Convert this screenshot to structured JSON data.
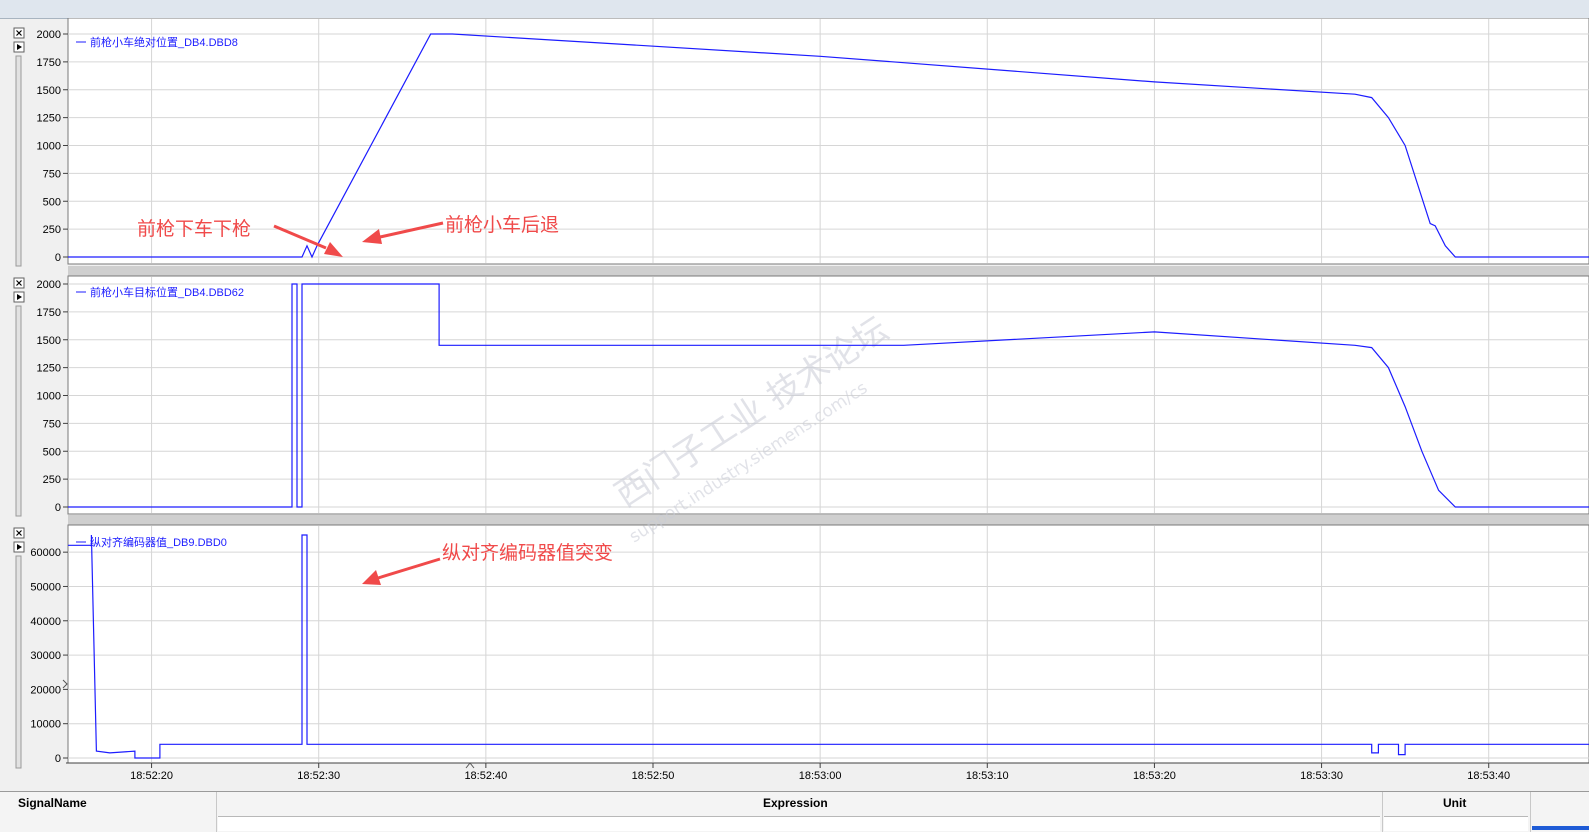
{
  "chart_data": [
    {
      "type": "line",
      "series": [
        {
          "name": "前枪小车绝对位置_DB4.DBD8",
          "x": [
            "18:52:15",
            "18:52:28.5",
            "18:52:29",
            "18:52:29.3",
            "18:52:29.6",
            "18:52:29.9",
            "18:52:36.7",
            "18:52:38",
            "18:53:00",
            "18:53:20",
            "18:53:32",
            "18:53:33",
            "18:53:34",
            "18:53:35",
            "18:53:36.5",
            "18:53:36.8",
            "18:53:37.4",
            "18:53:38",
            "18:53:38.5",
            "18:53:40",
            "18:53:46"
          ],
          "values": [
            0,
            0,
            0,
            100,
            0,
            100,
            2000,
            2000,
            1800,
            1570,
            1460,
            1430,
            1250,
            1000,
            300,
            280,
            100,
            0,
            0,
            0,
            0
          ]
        }
      ],
      "ylim": [
        0,
        2000
      ],
      "yticks": [
        "2000",
        "1750",
        "1500",
        "1250",
        "1000",
        "750",
        "500",
        "250",
        "0"
      ],
      "xlim": [
        "18:52:15",
        "18:53:46"
      ]
    },
    {
      "type": "line",
      "series": [
        {
          "name": "前枪小车目标位置_DB4.DBD62",
          "x": [
            "18:52:15",
            "18:52:28.4",
            "18:52:28.4",
            "18:52:28.7",
            "18:52:28.7",
            "18:52:29",
            "18:52:29",
            "18:52:37.2",
            "18:52:37.2",
            "18:53:05",
            "18:53:20",
            "18:53:32",
            "18:53:33",
            "18:53:34",
            "18:53:35",
            "18:53:36",
            "18:53:37",
            "18:53:38",
            "18:53:46"
          ],
          "values": [
            0,
            0,
            2000,
            2000,
            0,
            0,
            2000,
            2000,
            1450,
            1450,
            1570,
            1450,
            1430,
            1250,
            900,
            500,
            150,
            0,
            0
          ]
        }
      ],
      "ylim": [
        0,
        2000
      ],
      "yticks": [
        "2000",
        "1750",
        "1500",
        "1250",
        "1000",
        "750",
        "500",
        "250",
        "0"
      ],
      "xlim": [
        "18:52:15",
        "18:53:46"
      ]
    },
    {
      "type": "line",
      "series": [
        {
          "name": "纵对齐编码器值_DB9.DBD0",
          "x": [
            "18:52:15",
            "18:52:16.4",
            "18:52:16.4",
            "18:52:16.7",
            "18:52:17.5",
            "18:52:19",
            "18:52:19",
            "18:52:20.5",
            "18:52:20.5",
            "18:52:22",
            "18:52:28",
            "18:52:29",
            "18:52:29",
            "18:52:29.3",
            "18:52:29.3",
            "18:52:30",
            "18:53:33",
            "18:53:33",
            "18:53:33.4",
            "18:53:33.4",
            "18:53:34.6",
            "18:53:34.6",
            "18:53:35",
            "18:53:35",
            "18:53:46"
          ],
          "values": [
            62000,
            62000,
            65000,
            2000,
            1500,
            2000,
            0,
            0,
            4000,
            4000,
            4000,
            4000,
            65000,
            65000,
            4000,
            4000,
            4000,
            1500,
            1500,
            4000,
            4000,
            1000,
            1000,
            4000,
            4000
          ]
        }
      ],
      "ylim": [
        0,
        65000
      ],
      "yticks": [
        "60000",
        "50000",
        "40000",
        "30000",
        "20000",
        "10000",
        "0"
      ],
      "xlim": [
        "18:52:15",
        "18:53:46"
      ]
    }
  ],
  "x_axis": {
    "ticks": [
      "18:52:20",
      "18:52:30",
      "18:52:40",
      "18:52:50",
      "18:53:00",
      "18:53:10",
      "18:53:20",
      "18:53:30",
      "18:53:40"
    ]
  },
  "annotations": [
    "前枪下车下枪",
    "前枪小车后退",
    "纵对齐编码器值突变"
  ],
  "watermark": {
    "line1": "西门子工业 技术论坛",
    "line2": "support.industry.siemens.com/cs"
  },
  "table": {
    "headers": [
      "SignalName",
      "Expression",
      "Unit"
    ]
  },
  "colors": {
    "series": "#1c1cff",
    "annotation": "#f04a4a",
    "grid": "#d6d6d6"
  }
}
